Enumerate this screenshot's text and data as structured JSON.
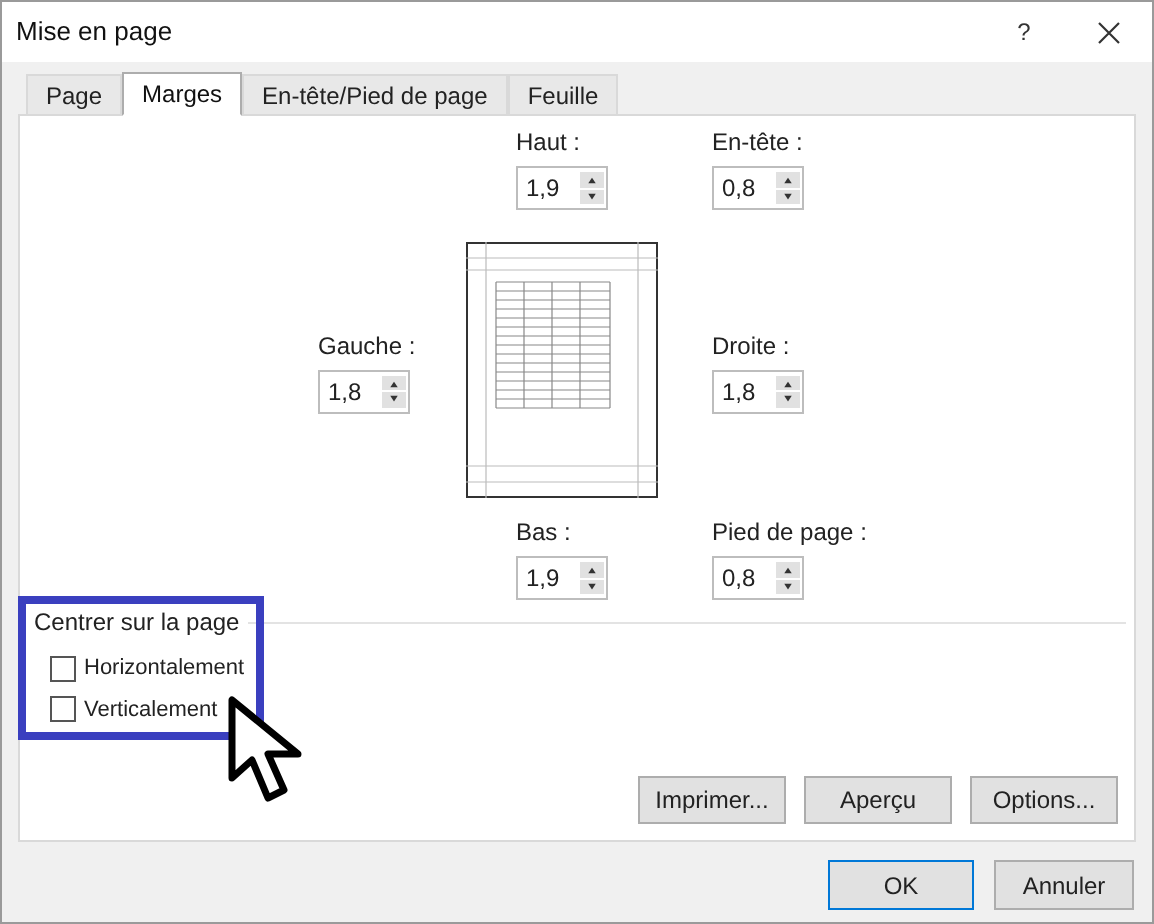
{
  "window": {
    "title": "Mise en page",
    "help": "?"
  },
  "tabs": [
    {
      "label": "Page",
      "selected": false
    },
    {
      "label": "Marges",
      "selected": true
    },
    {
      "label": "En-tête/Pied de page",
      "selected": false
    },
    {
      "label": "Feuille",
      "selected": false
    }
  ],
  "margins": {
    "top": {
      "label": "Haut :",
      "value": "1,9"
    },
    "header": {
      "label": "En-tête :",
      "value": "0,8"
    },
    "left": {
      "label": "Gauche :",
      "value": "1,8"
    },
    "right": {
      "label": "Droite :",
      "value": "1,8"
    },
    "bottom": {
      "label": "Bas :",
      "value": "1,9"
    },
    "footer": {
      "label": "Pied de page :",
      "value": "0,8"
    }
  },
  "center_on_page": {
    "title": "Centrer sur la page",
    "options": [
      {
        "label": "Horizontalement",
        "checked": false
      },
      {
        "label": "Verticalement",
        "checked": false
      }
    ]
  },
  "panel_buttons": [
    "Imprimer...",
    "Aperçu",
    "Options..."
  ],
  "footer_buttons": [
    {
      "label": "OK",
      "default": true
    },
    {
      "label": "Annuler",
      "default": false
    }
  ]
}
